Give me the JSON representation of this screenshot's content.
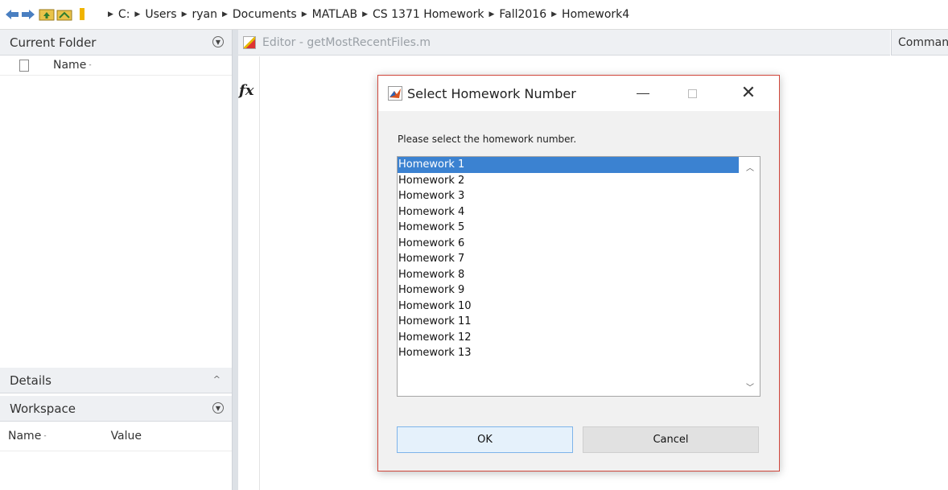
{
  "breadcrumb": [
    "C:",
    "Users",
    "ryan",
    "Documents",
    "MATLAB",
    "CS 1371 Homework",
    "Fall2016",
    "Homework4"
  ],
  "current_folder": {
    "title": "Current Folder",
    "column_name": "Name",
    "sort_indicator": "-"
  },
  "details": {
    "title": "Details"
  },
  "workspace": {
    "title": "Workspace",
    "column_name": "Name",
    "column_value": "Value",
    "sort_indicator": "-"
  },
  "editor": {
    "tab_label": "Editor - getMostRecentFiles.m",
    "fx_symbol": "fx"
  },
  "command_window": {
    "tab_label": "Command Window"
  },
  "dialog": {
    "title": "Select Homework Number",
    "prompt": "Please select the homework number.",
    "items": [
      "Homework 1",
      "Homework 2",
      "Homework 3",
      "Homework 4",
      "Homework 5",
      "Homework 6",
      "Homework 7",
      "Homework 8",
      "Homework 9",
      "Homework 10",
      "Homework 11",
      "Homework 12",
      "Homework 13"
    ],
    "selected_index": 0,
    "ok_label": "OK",
    "cancel_label": "Cancel"
  },
  "colors": {
    "selection": "#3b82d1",
    "dialog_border": "#d0463b",
    "panel_header": "#eef0f3"
  }
}
